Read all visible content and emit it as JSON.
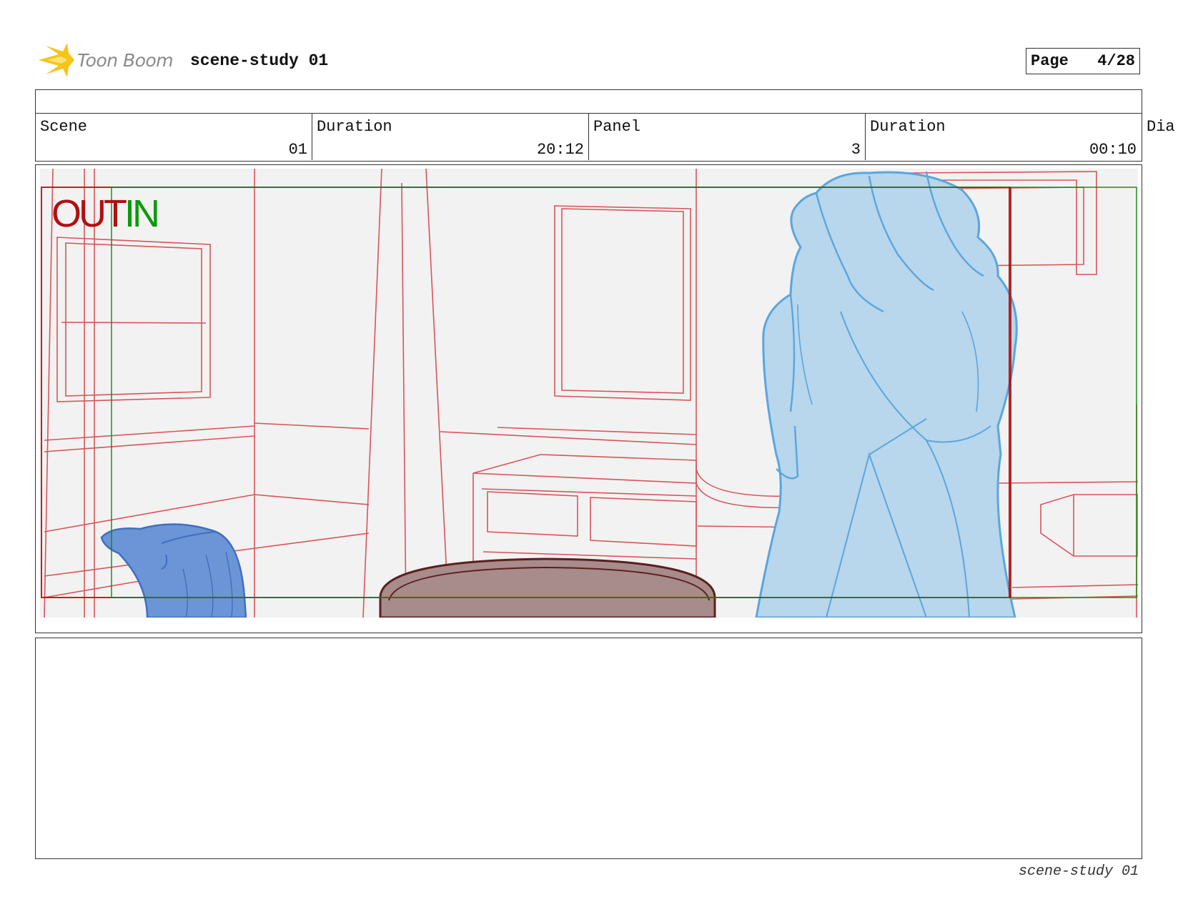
{
  "header": {
    "brand": "Toon Boom",
    "project_title": "scene-study 01",
    "page_label": "Page",
    "page_value": "4/28"
  },
  "info": {
    "scene_label": "Scene",
    "scene_value": "01",
    "scene_duration_label": "Duration",
    "scene_duration_value": "20:12",
    "panel_label": "Panel",
    "panel_value": "3",
    "panel_duration_label": "Duration",
    "panel_duration_value": "00:10",
    "dialog_label": "Dia"
  },
  "panel": {
    "out_label": "OUT",
    "in_label": "IN",
    "colors": {
      "out_frame": "#b01010",
      "in_frame": "#0a8a0a",
      "layout_lines": "#d9545a",
      "character": "#5aa6df",
      "prop_blue": "#5d8fd6",
      "table": "#a88b8b"
    }
  },
  "footer": {
    "project_name": "scene-study 01"
  }
}
